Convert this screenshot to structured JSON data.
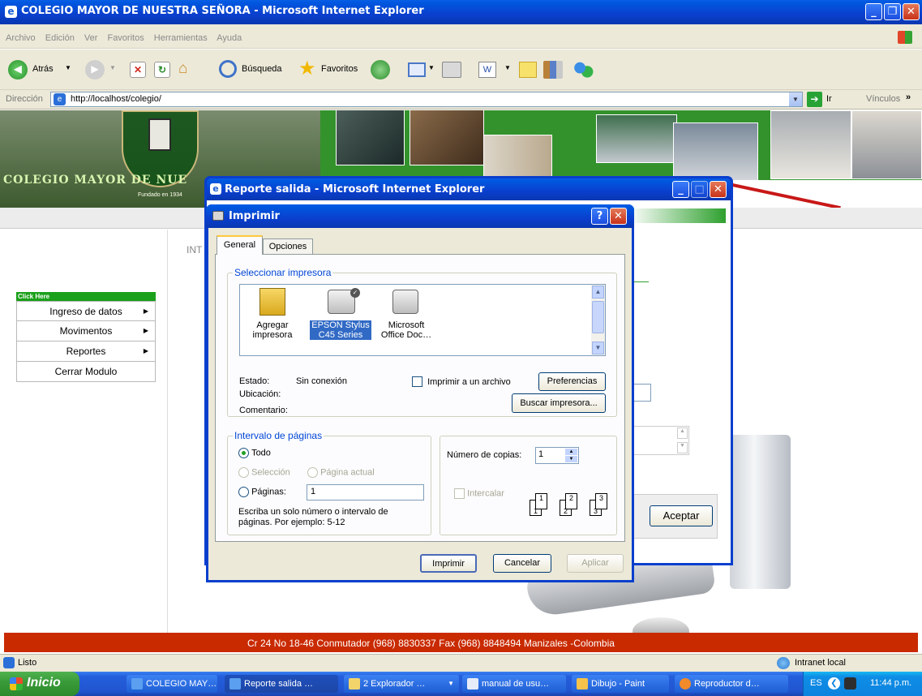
{
  "browser": {
    "title": "COLEGIO MAYOR DE NUESTRA SEÑORA - Microsoft Internet Explorer",
    "menu": [
      "Archivo",
      "Edición",
      "Ver",
      "Favoritos",
      "Herramientas",
      "Ayuda"
    ],
    "toolbar": {
      "back": "Atrás",
      "search": "Búsqueda",
      "favorites": "Favoritos"
    },
    "address_label": "Dirección",
    "address": "http://localhost/colegio/",
    "go": "Ir",
    "links": "Vínculos"
  },
  "site": {
    "banner_title": "COLEGIO MAYOR DE NUE",
    "founded": "Fundado en 1934",
    "content_fragment": "INT",
    "menu_header": "Click Here",
    "menu": [
      {
        "label": "Ingreso de datos"
      },
      {
        "label": "Movimentos"
      },
      {
        "label": "Reportes"
      },
      {
        "label": "Cerrar Modulo"
      }
    ],
    "footer": "Cr 24 No 18-46 Conmutador (968) 8830337 Fax (968) 8848494 Manizales -Colombia"
  },
  "popup": {
    "title": "Reporte salida - Microsoft Internet Explorer",
    "accept": "Aceptar"
  },
  "print_dialog": {
    "title": "Imprimir",
    "tabs": [
      "General",
      "Opciones"
    ],
    "select_printer_label": "Seleccionar impresora",
    "printers": [
      {
        "name": "Agregar impresora",
        "line1": "Agregar",
        "line2": "impresora"
      },
      {
        "name": "EPSON Stylus C45 Series",
        "line1": "EPSON Stylus",
        "line2": "C45 Series"
      },
      {
        "name": "Microsoft Office Doc…",
        "line1": "Microsoft",
        "line2": "Office Doc…"
      }
    ],
    "status_label": "Estado:",
    "status_value": "Sin conexión",
    "location_label": "Ubicación:",
    "comment_label": "Comentario:",
    "print_to_file": "Imprimir a un archivo",
    "preferences": "Preferencias",
    "find_printer": "Buscar impresora...",
    "page_range_label": "Intervalo de páginas",
    "all": "Todo",
    "selection": "Selección",
    "current_page": "Página actual",
    "pages": "Páginas:",
    "pages_value": "1",
    "hint_line1": "Escriba un solo número o intervalo de",
    "hint_line2": "páginas. Por ejemplo: 5-12",
    "copies_label": "Número de copias:",
    "copies_value": "1",
    "collate": "Intercalar",
    "print_btn": "Imprimir",
    "cancel_btn": "Cancelar",
    "apply_btn": "Aplicar"
  },
  "status_bar": {
    "left": "Listo",
    "zone": "Intranet local"
  },
  "taskbar": {
    "start": "Inicio",
    "tasks": [
      "COLEGIO MAY…",
      "Reporte salida …",
      "2 Explorador …",
      "manual de usu…",
      "Dibujo - Paint",
      "Reproductor d…"
    ],
    "lang": "ES",
    "clock": "11:44 p.m."
  }
}
